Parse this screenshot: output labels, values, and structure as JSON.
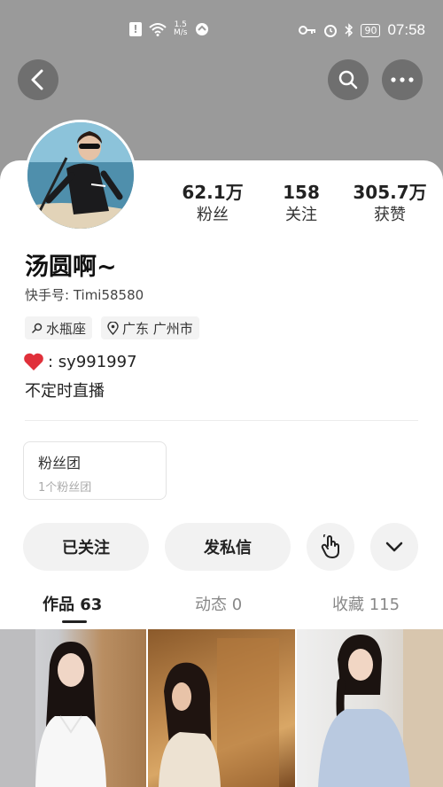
{
  "status_bar": {
    "alert_badge": "!",
    "speed_value": "1.5",
    "speed_unit": "M/s",
    "battery": "90",
    "time": "07:58"
  },
  "icons": {
    "back": "chevron-left-icon",
    "search": "search-icon",
    "more": "more-dots-icon",
    "zodiac": "search-icon",
    "location": "location-pin-icon",
    "heart": "heart-icon",
    "hand": "hand-pointer-icon",
    "chevron": "chevron-down-icon"
  },
  "profile": {
    "name": "汤圆啊~",
    "kuaishou_id": "快手号: Timi58580",
    "tags": [
      "水瓶座",
      "广东 广州市"
    ],
    "contact": ":  sy991997",
    "bio": "不定时直播"
  },
  "stats": [
    {
      "value": "62.1万",
      "label": "粉丝"
    },
    {
      "value": "158",
      "label": "关注"
    },
    {
      "value": "305.7万",
      "label": "获赞"
    }
  ],
  "fan_club": {
    "title": "粉丝团",
    "subtitle": "1个粉丝团"
  },
  "actions": {
    "follow": "已关注",
    "message": "发私信"
  },
  "tabs": [
    {
      "label": "作品 63",
      "active": true
    },
    {
      "label": "动态 0",
      "active": false
    },
    {
      "label": "收藏 115",
      "active": false
    }
  ],
  "colors": {
    "header": "#9a9a9a",
    "heart": "#e0303a"
  }
}
